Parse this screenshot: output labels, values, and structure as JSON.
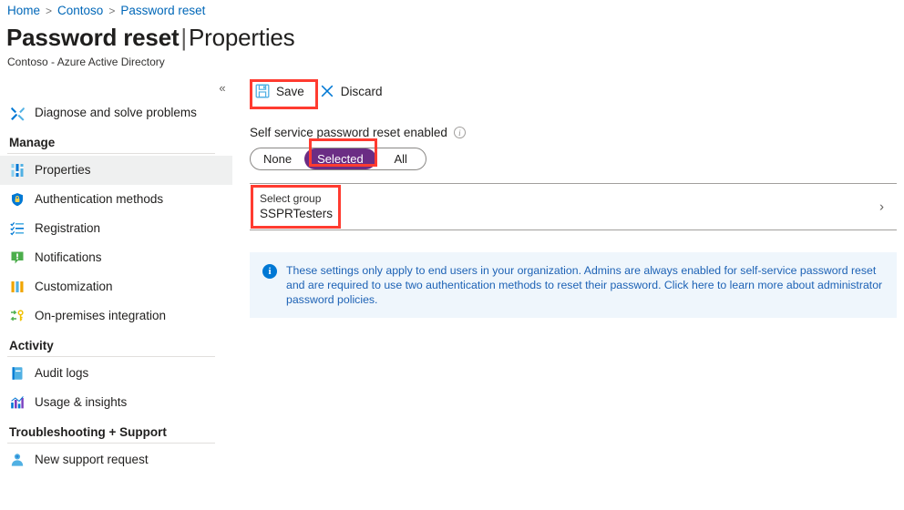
{
  "breadcrumb": {
    "items": [
      "Home",
      "Contoso",
      "Password reset"
    ],
    "separator": ">"
  },
  "header": {
    "title": "Password reset",
    "separator": "|",
    "subtitle_segment": "Properties",
    "subtext": "Contoso - Azure Active Directory",
    "collapse_icon": "«"
  },
  "sidebar": {
    "top_item": {
      "label": "Diagnose and solve problems",
      "icon": "wrench-icon"
    },
    "groups": [
      {
        "title": "Manage",
        "items": [
          {
            "label": "Properties",
            "icon": "sliders-icon",
            "selected": true
          },
          {
            "label": "Authentication methods",
            "icon": "shield-lock-icon",
            "selected": false
          },
          {
            "label": "Registration",
            "icon": "checklist-icon",
            "selected": false
          },
          {
            "label": "Notifications",
            "icon": "notification-icon",
            "selected": false
          },
          {
            "label": "Customization",
            "icon": "bars-icon",
            "selected": false
          },
          {
            "label": "On-premises integration",
            "icon": "sync-key-icon",
            "selected": false
          }
        ]
      },
      {
        "title": "Activity",
        "items": [
          {
            "label": "Audit logs",
            "icon": "book-icon",
            "selected": false
          },
          {
            "label": "Usage & insights",
            "icon": "chart-icon",
            "selected": false
          }
        ]
      },
      {
        "title": "Troubleshooting + Support",
        "items": [
          {
            "label": "New support request",
            "icon": "person-icon",
            "selected": false
          }
        ]
      }
    ]
  },
  "toolbar": {
    "save_label": "Save",
    "save_icon": "save-disk-icon",
    "discard_label": "Discard",
    "discard_icon": "close-x-icon"
  },
  "settings": {
    "enabled_label": "Self service password reset enabled",
    "info_icon": "info-circle-icon",
    "options": [
      "None",
      "Selected",
      "All"
    ],
    "selected_option": "Selected",
    "selected_color": "#6b2d84"
  },
  "group_picker": {
    "caption": "Select group",
    "value": "SSPRTesters",
    "chevron": "›"
  },
  "info_banner": {
    "icon": "info-icon",
    "text": "These settings only apply to end users in your organization. Admins are always enabled for self-service password reset and are required to use two authentication methods to reset their password. Click here to learn more about administrator password policies.",
    "background": "#eff6fc",
    "text_color": "#1d62b5"
  },
  "annotations": {
    "highlight_color": "#ff3b30",
    "highlighted": [
      "save-button",
      "selected-pill",
      "select-group-field"
    ]
  }
}
